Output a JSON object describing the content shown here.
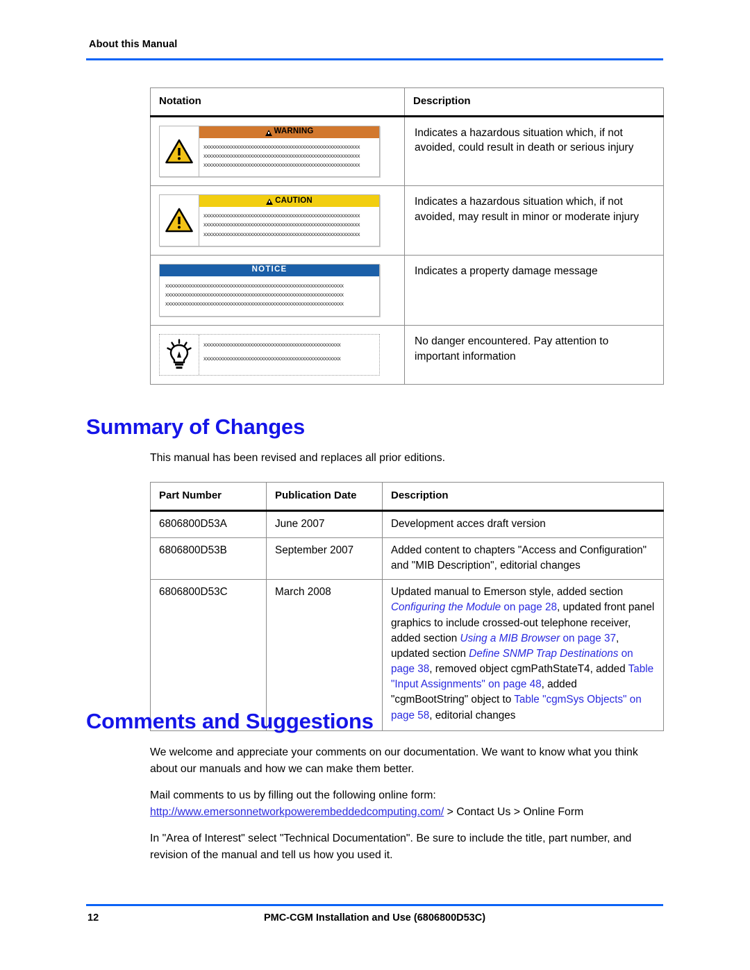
{
  "header": {
    "running_head": "About this Manual"
  },
  "notation_table": {
    "columns": [
      "Notation",
      "Description"
    ],
    "rows": [
      {
        "notation_kind": "warning-box",
        "bar_label": "WARNING",
        "bar_color": "#d2782e",
        "has_icon": true,
        "icon": "warning-triangle-icon",
        "placeholder_lines": [
          "xxxxxxxxxxxxxxxxxxxxxxxxxxxxxxxxxxxxxxxxxxxxxxxxxxxxxxxxx",
          "xxxxxxxxxxxxxxxxxxxxxxxxxxxxxxxxxxxxxxxxxxxxxxxxxxxxxxxxx",
          "xxxxxxxxxxxxxxxxxxxxxxxxxxxxxxxxxxxxxxxxxxxxxxxxxxxxxxxxx"
        ],
        "description": "Indicates a hazardous situation which, if not avoided, could result in death or serious injury"
      },
      {
        "notation_kind": "caution-box",
        "bar_label": "CAUTION",
        "bar_color": "#f2ce10",
        "has_icon": true,
        "icon": "warning-triangle-icon",
        "placeholder_lines": [
          "xxxxxxxxxxxxxxxxxxxxxxxxxxxxxxxxxxxxxxxxxxxxxxxxxxxxxxxxx",
          "xxxxxxxxxxxxxxxxxxxxxxxxxxxxxxxxxxxxxxxxxxxxxxxxxxxxxxxxx",
          "xxxxxxxxxxxxxxxxxxxxxxxxxxxxxxxxxxxxxxxxxxxxxxxxxxxxxxxxx"
        ],
        "description": "Indicates a hazardous situation which, if not avoided, may result in minor or moderate injury"
      },
      {
        "notation_kind": "notice-box",
        "bar_label": "NOTICE",
        "bar_color": "#1b5fa8",
        "has_icon": false,
        "icon": null,
        "placeholder_lines": [
          "xxxxxxxxxxxxxxxxxxxxxxxxxxxxxxxxxxxxxxxxxxxxxxxxxxxxxxxxxxxxxxxxx",
          "xxxxxxxxxxxxxxxxxxxxxxxxxxxxxxxxxxxxxxxxxxxxxxxxxxxxxxxxxxxxxxxxx",
          "xxxxxxxxxxxxxxxxxxxxxxxxxxxxxxxxxxxxxxxxxxxxxxxxxxxxxxxxxxxxxxxxx"
        ],
        "description": "Indicates a property damage message"
      },
      {
        "notation_kind": "tip-box",
        "bar_label": null,
        "bar_color": null,
        "has_icon": true,
        "icon": "lightbulb-icon",
        "placeholder_lines": [
          "xxxxxxxxxxxxxxxxxxxxxxxxxxxxxxxxxxxxxxxxxxxxxxxxxx",
          "xxxxxxxxxxxxxxxxxxxxxxxxxxxxxxxxxxxxxxxxxxxxxxxxxx"
        ],
        "description": "No danger encountered. Pay attention to important information"
      }
    ]
  },
  "summary_of_changes": {
    "heading": "Summary of Changes",
    "intro": "This manual has been revised and replaces all prior editions.",
    "columns": [
      "Part Number",
      "Publication Date",
      "Description"
    ],
    "rows": [
      {
        "part_number": "6806800D53A",
        "publication_date": "June 2007",
        "description_plain": "Development acces draft version"
      },
      {
        "part_number": "6806800D53B",
        "publication_date": "September 2007",
        "description_plain": "Added content to chapters \"Access and Configuration\" and \"MIB Description\", editorial changes"
      },
      {
        "part_number": "6806800D53C",
        "publication_date": "March 2008",
        "description_plain": "Updated manual to Emerson style, added section Configuring the Module on page 28, updated front panel graphics to include crossed-out telephone receiver, added section Using a MIB Browser on page 37, updated section Define SNMP Trap Destinations on page 38, removed object cgmPathStateT4, added Table \"Input Assignments\" on page 48, added \"cgmBootString\" object to Table \"cgmSys Objects\" on page 58, editorial changes",
        "description_runs": [
          {
            "text": "Updated manual to Emerson style, added section ",
            "style": "plain"
          },
          {
            "text": "Configuring the Module",
            "style": "link-italic"
          },
          {
            "text": " ",
            "style": "plain"
          },
          {
            "text": "on page 28",
            "style": "link"
          },
          {
            "text": ", updated front panel graphics to include crossed-out telephone receiver, added section ",
            "style": "plain"
          },
          {
            "text": "Using a MIB Browser",
            "style": "link-italic"
          },
          {
            "text": " ",
            "style": "plain"
          },
          {
            "text": "on page 37",
            "style": "link"
          },
          {
            "text": ", updated section ",
            "style": "plain"
          },
          {
            "text": "Define SNMP Trap Destinations",
            "style": "link-italic"
          },
          {
            "text": " ",
            "style": "plain"
          },
          {
            "text": "on page 38",
            "style": "link"
          },
          {
            "text": ", removed object cgmPathStateT4, added ",
            "style": "plain"
          },
          {
            "text": "Table \"Input Assignments\" on page 48",
            "style": "link"
          },
          {
            "text": ", added \"cgmBootString\" object to ",
            "style": "plain"
          },
          {
            "text": "Table \"cgmSys Objects\" on page 58",
            "style": "link"
          },
          {
            "text": ", editorial changes",
            "style": "plain"
          }
        ]
      }
    ]
  },
  "comments_and_suggestions": {
    "heading": "Comments and Suggestions",
    "paragraph_1": "We welcome and appreciate your comments on our documentation. We want to know what you think about our manuals and how we can make them better.",
    "paragraph_2_prefix": "Mail comments to us by filling out the following online form:",
    "url": "http://www.emersonnetworkpowerembeddedcomputing.com/",
    "url_suffix": " > Contact Us > Online Form",
    "paragraph_3": "In \"Area of Interest\" select \"Technical Documentation\". Be sure to include the title, part number, and revision of the manual and tell us how you used it."
  },
  "footer": {
    "page_number": "12",
    "document_title": "PMC-CGM Installation and Use (6806800D53C)"
  },
  "colors": {
    "heading_blue": "#1515e8",
    "rule_blue": "#0b63f6",
    "link_blue": "#2a2ae0",
    "warning_orange": "#d2782e",
    "caution_yellow": "#f2ce10",
    "notice_blue": "#1b5fa8"
  }
}
